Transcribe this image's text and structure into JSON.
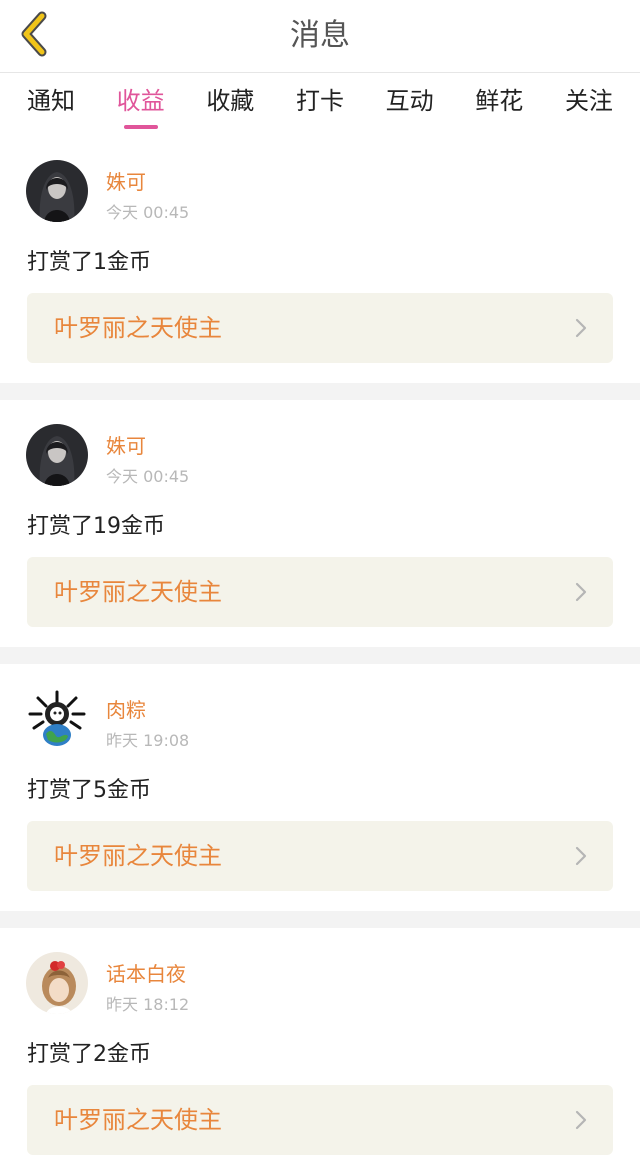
{
  "header": {
    "title": "消息",
    "back_icon": "chevron-left-icon",
    "accent_color": "#f0c419"
  },
  "tabs": [
    {
      "label": "通知",
      "active": false
    },
    {
      "label": "收益",
      "active": true
    },
    {
      "label": "收藏",
      "active": false
    },
    {
      "label": "打卡",
      "active": false
    },
    {
      "label": "互动",
      "active": false
    },
    {
      "label": "鲜花",
      "active": false
    },
    {
      "label": "关注",
      "active": false
    }
  ],
  "theme": {
    "active_tab_color": "#e0559a",
    "name_color": "#e8863c",
    "link_bg": "#f4f3ea"
  },
  "items": [
    {
      "user": "姝可",
      "time": "今天 00:45",
      "message": "打赏了1金币",
      "work_title": "叶罗丽之天使主",
      "avatar": "dark-portrait-avatar"
    },
    {
      "user": "姝可",
      "time": "今天 00:45",
      "message": "打赏了19金币",
      "work_title": "叶罗丽之天使主",
      "avatar": "dark-portrait-avatar"
    },
    {
      "user": "肉粽",
      "time": "昨天 19:08",
      "message": "打赏了5金币",
      "work_title": "叶罗丽之天使主",
      "avatar": "cartoon-globe-avatar"
    },
    {
      "user": "话本白夜",
      "time": "昨天 18:12",
      "message": "打赏了2金币",
      "work_title": "叶罗丽之天使主",
      "avatar": "anime-girl-avatar"
    }
  ]
}
